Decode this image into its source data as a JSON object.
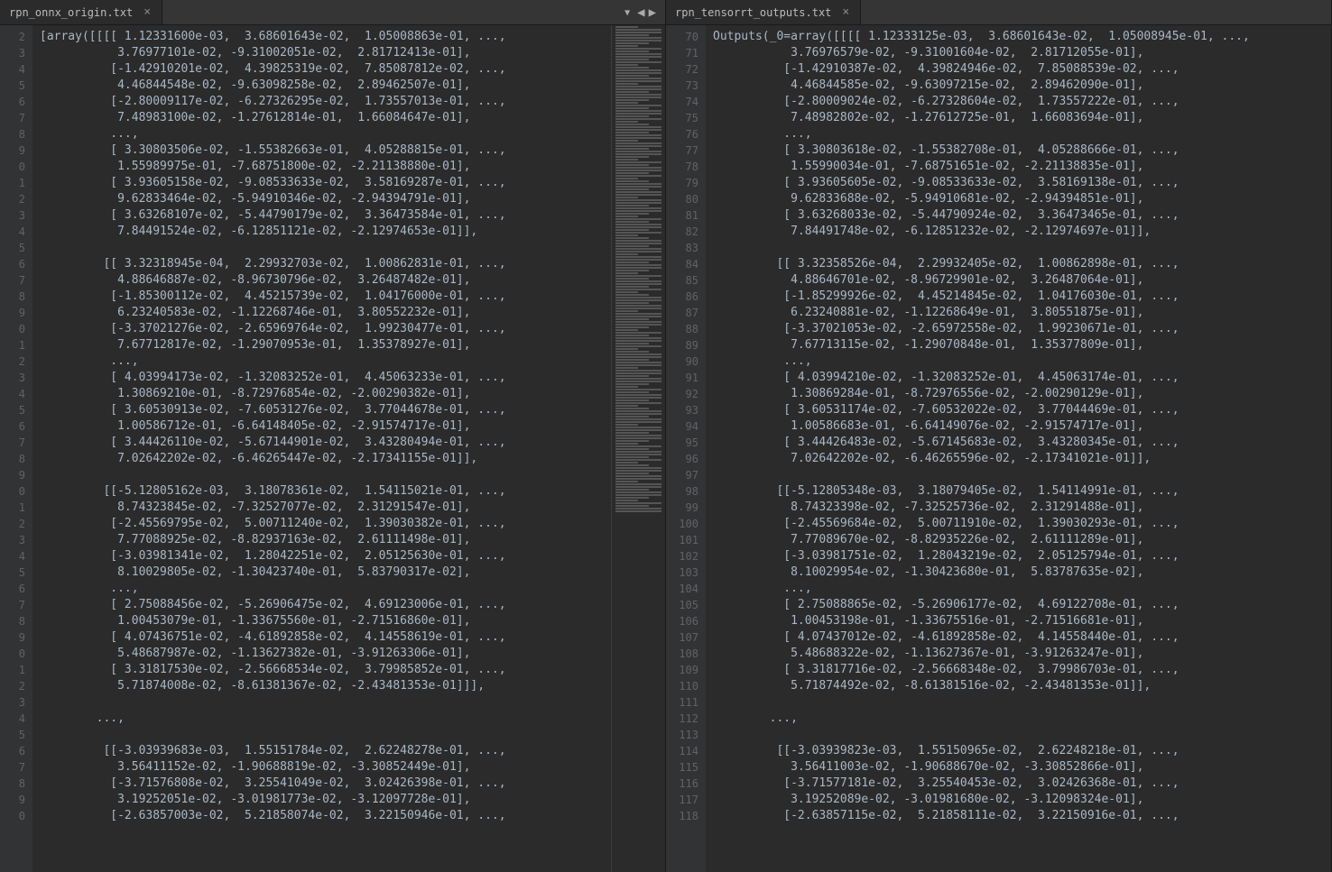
{
  "left_pane": {
    "tab_title": "rpn_onnx_origin.txt",
    "line_start": 2,
    "lines": [
      "[array([[[[ 1.12331600e-03,  3.68601643e-02,  1.05008863e-01, ...,",
      "           3.76977101e-02, -9.31002051e-02,  2.81712413e-01],",
      "          [-1.42910201e-02,  4.39825319e-02,  7.85087812e-02, ...,",
      "           4.46844548e-02, -9.63098258e-02,  2.89462507e-01],",
      "          [-2.80009117e-02, -6.27326295e-02,  1.73557013e-01, ...,",
      "           7.48983100e-02, -1.27612814e-01,  1.66084647e-01],",
      "          ...,",
      "          [ 3.30803506e-02, -1.55382663e-01,  4.05288815e-01, ...,",
      "           1.55989975e-01, -7.68751800e-02, -2.21138880e-01],",
      "          [ 3.93605158e-02, -9.08533633e-02,  3.58169287e-01, ...,",
      "           9.62833464e-02, -5.94910346e-02, -2.94394791e-01],",
      "          [ 3.63268107e-02, -5.44790179e-02,  3.36473584e-01, ...,",
      "           7.84491524e-02, -6.12851121e-02, -2.12974653e-01]],",
      "",
      "         [[ 3.32318945e-04,  2.29932703e-02,  1.00862831e-01, ...,",
      "           4.88646887e-02, -8.96730796e-02,  3.26487482e-01],",
      "          [-1.85300112e-02,  4.45215739e-02,  1.04176000e-01, ...,",
      "           6.23240583e-02, -1.12268746e-01,  3.80552232e-01],",
      "          [-3.37021276e-02, -2.65969764e-02,  1.99230477e-01, ...,",
      "           7.67712817e-02, -1.29070953e-01,  1.35378927e-01],",
      "          ...,",
      "          [ 4.03994173e-02, -1.32083252e-01,  4.45063233e-01, ...,",
      "           1.30869210e-01, -8.72976854e-02, -2.00290382e-01],",
      "          [ 3.60530913e-02, -7.60531276e-02,  3.77044678e-01, ...,",
      "           1.00586712e-01, -6.64148405e-02, -2.91574717e-01],",
      "          [ 3.44426110e-02, -5.67144901e-02,  3.43280494e-01, ...,",
      "           7.02642202e-02, -6.46265447e-02, -2.17341155e-01]],",
      "",
      "         [[-5.12805162e-03,  3.18078361e-02,  1.54115021e-01, ...,",
      "           8.74323845e-02, -7.32527077e-02,  2.31291547e-01],",
      "          [-2.45569795e-02,  5.00711240e-02,  1.39030382e-01, ...,",
      "           7.77088925e-02, -8.82937163e-02,  2.61111498e-01],",
      "          [-3.03981341e-02,  1.28042251e-02,  2.05125630e-01, ...,",
      "           8.10029805e-02, -1.30423740e-01,  5.83790317e-02],",
      "          ...,",
      "          [ 2.75088456e-02, -5.26906475e-02,  4.69123006e-01, ...,",
      "           1.00453079e-01, -1.33675560e-01, -2.71516860e-01],",
      "          [ 4.07436751e-02, -4.61892858e-02,  4.14558619e-01, ...,",
      "           5.48687987e-02, -1.13627382e-01, -3.91263306e-01],",
      "          [ 3.31817530e-02, -2.56668534e-02,  3.79985852e-01, ...,",
      "           5.71874008e-02, -8.61381367e-02, -2.43481353e-01]]],",
      "",
      "        ...,",
      "",
      "         [[-3.03939683e-03,  1.55151784e-02,  2.62248278e-01, ...,",
      "           3.56411152e-02, -1.90688819e-02, -3.30852449e-01],",
      "          [-3.71576808e-02,  3.25541049e-02,  3.02426398e-01, ...,",
      "           3.19252051e-02, -3.01981773e-02, -3.12097728e-01],",
      "          [-2.63857003e-02,  5.21858074e-02,  3.22150946e-01, ...,"
    ]
  },
  "right_pane": {
    "tab_title": "rpn_tensorrt_outputs.txt",
    "line_start": 70,
    "lines": [
      "Outputs(_0=array([[[[ 1.12333125e-03,  3.68601643e-02,  1.05008945e-01, ...,",
      "           3.76976579e-02, -9.31001604e-02,  2.81712055e-01],",
      "          [-1.42910387e-02,  4.39824946e-02,  7.85088539e-02, ...,",
      "           4.46844585e-02, -9.63097215e-02,  2.89462090e-01],",
      "          [-2.80009024e-02, -6.27328604e-02,  1.73557222e-01, ...,",
      "           7.48982802e-02, -1.27612725e-01,  1.66083694e-01],",
      "          ...,",
      "          [ 3.30803618e-02, -1.55382708e-01,  4.05288666e-01, ...,",
      "           1.55990034e-01, -7.68751651e-02, -2.21138835e-01],",
      "          [ 3.93605605e-02, -9.08533633e-02,  3.58169138e-01, ...,",
      "           9.62833688e-02, -5.94910681e-02, -2.94394851e-01],",
      "          [ 3.63268033e-02, -5.44790924e-02,  3.36473465e-01, ...,",
      "           7.84491748e-02, -6.12851232e-02, -2.12974697e-01]],",
      "",
      "         [[ 3.32358526e-04,  2.29932405e-02,  1.00862898e-01, ...,",
      "           4.88646701e-02, -8.96729901e-02,  3.26487064e-01],",
      "          [-1.85299926e-02,  4.45214845e-02,  1.04176030e-01, ...,",
      "           6.23240881e-02, -1.12268649e-01,  3.80551875e-01],",
      "          [-3.37021053e-02, -2.65972558e-02,  1.99230671e-01, ...,",
      "           7.67713115e-02, -1.29070848e-01,  1.35377809e-01],",
      "          ...,",
      "          [ 4.03994210e-02, -1.32083252e-01,  4.45063174e-01, ...,",
      "           1.30869284e-01, -8.72976556e-02, -2.00290129e-01],",
      "          [ 3.60531174e-02, -7.60532022e-02,  3.77044469e-01, ...,",
      "           1.00586683e-01, -6.64149076e-02, -2.91574717e-01],",
      "          [ 3.44426483e-02, -5.67145683e-02,  3.43280345e-01, ...,",
      "           7.02642202e-02, -6.46265596e-02, -2.17341021e-01]],",
      "",
      "         [[-5.12805348e-03,  3.18079405e-02,  1.54114991e-01, ...,",
      "           8.74323398e-02, -7.32525736e-02,  2.31291488e-01],",
      "          [-2.45569684e-02,  5.00711910e-02,  1.39030293e-01, ...,",
      "           7.77089670e-02, -8.82935226e-02,  2.61111289e-01],",
      "          [-3.03981751e-02,  1.28043219e-02,  2.05125794e-01, ...,",
      "           8.10029954e-02, -1.30423680e-01,  5.83787635e-02],",
      "          ...,",
      "          [ 2.75088865e-02, -5.26906177e-02,  4.69122708e-01, ...,",
      "           1.00453198e-01, -1.33675516e-01, -2.71516681e-01],",
      "          [ 4.07437012e-02, -4.61892858e-02,  4.14558440e-01, ...,",
      "           5.48688322e-02, -1.13627367e-01, -3.91263247e-01],",
      "          [ 3.31817716e-02, -2.56668348e-02,  3.79986703e-01, ...,",
      "           5.71874492e-02, -8.61381516e-02, -2.43481353e-01]],",
      "",
      "        ...,",
      "",
      "         [[-3.03939823e-03,  1.55150965e-02,  2.62248218e-01, ...,",
      "           3.56411003e-02, -1.90688670e-02, -3.30852866e-01],",
      "          [-3.71577181e-02,  3.25540453e-02,  3.02426368e-01, ...,",
      "           3.19252089e-02, -3.01981680e-02, -3.12098324e-01],",
      "          [-2.63857115e-02,  5.21858111e-02,  3.22150916e-01, ...,"
    ]
  }
}
